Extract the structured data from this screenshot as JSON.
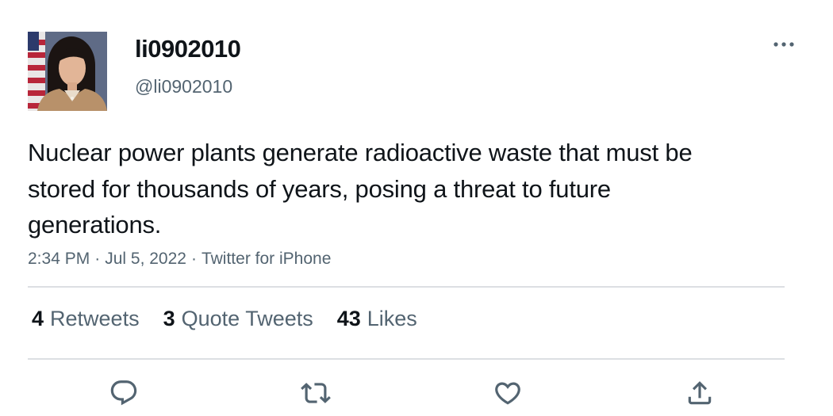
{
  "user": {
    "display_name": "li0902010",
    "handle": "@li0902010",
    "avatar_icon": "profile-photo"
  },
  "tweet": {
    "text": "Nuclear power plants generate radioactive waste that must be stored for thousands of years, posing a threat to future generations.",
    "time": "2:34 PM",
    "date": "Jul 5, 2022",
    "source": "Twitter for iPhone",
    "separator": "·"
  },
  "stats": {
    "retweets_count": "4",
    "retweets_label": "Retweets",
    "quotes_count": "3",
    "quotes_label": "Quote Tweets",
    "likes_count": "43",
    "likes_label": "Likes"
  },
  "actions": [
    "reply-icon",
    "retweet-icon",
    "like-icon",
    "share-icon"
  ],
  "colors": {
    "text_primary": "#0f1419",
    "text_secondary": "#536471",
    "divider": "#dcdfe3"
  }
}
